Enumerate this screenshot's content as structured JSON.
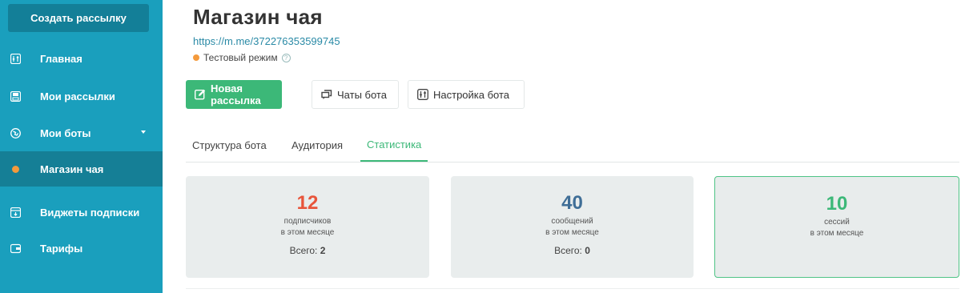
{
  "sidebar": {
    "create_button": "Создать рассылку",
    "items": [
      {
        "label": "Главная",
        "icon": "home-icon"
      },
      {
        "label": "Мои рассылки",
        "icon": "save-icon"
      },
      {
        "label": "Мои боты",
        "icon": "globe-icon"
      },
      {
        "label": "Магазин чая",
        "icon": "orange-dot"
      },
      {
        "label": "Виджеты подписки",
        "icon": "widget-icon"
      },
      {
        "label": "Тарифы",
        "icon": "wallet-icon"
      }
    ]
  },
  "header": {
    "title": "Магазин чая",
    "link": "https://m.me/372276353599745",
    "mode": "Тестовый режим",
    "help": "?"
  },
  "toolbar": {
    "new_broadcast": "Новая рассылка",
    "bot_chats": "Чаты бота",
    "bot_settings": "Настройка бота"
  },
  "tabs": [
    {
      "label": "Структура бота"
    },
    {
      "label": "Аудитория"
    },
    {
      "label": "Статистика"
    }
  ],
  "stats": [
    {
      "value": "12",
      "label1": "подписчиков",
      "label2": "в этом месяце",
      "total_label": "Всего:",
      "total_value": "2",
      "color": "#e8553b"
    },
    {
      "value": "40",
      "label1": "сообщений",
      "label2": "в этом месяце",
      "total_label": "Всего:",
      "total_value": "0",
      "color": "#3f6e97"
    },
    {
      "value": "10",
      "label1": "сессий",
      "label2": "в этом месяце",
      "total_label": "",
      "total_value": "",
      "color": "#3cb878"
    }
  ],
  "colors": {
    "sidebar": "#1a9fbd",
    "accent_green": "#3cb878",
    "link": "#2a8aa6",
    "orange": "#f49a3c"
  }
}
